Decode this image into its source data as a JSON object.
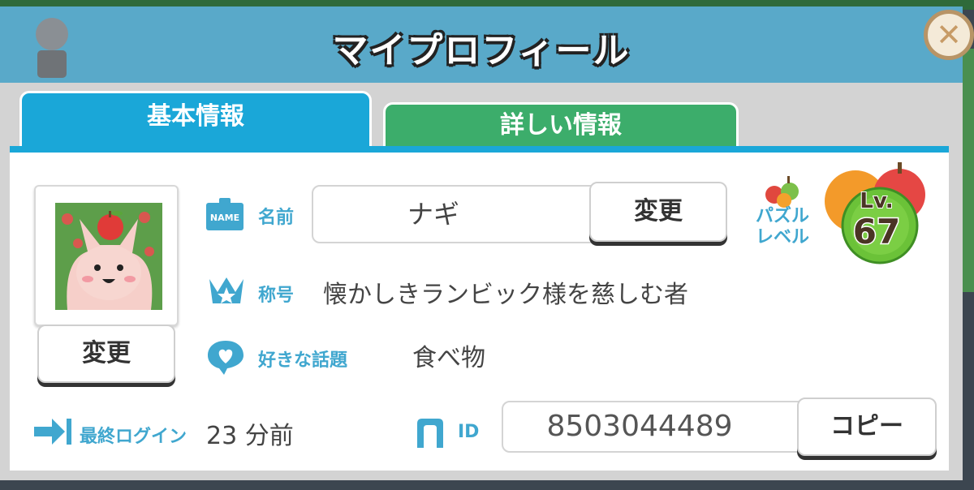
{
  "header": {
    "title": "マイプロフィール"
  },
  "tabs": [
    {
      "label": "基本情報",
      "active": true
    },
    {
      "label": "詳しい情報",
      "active": false
    }
  ],
  "avatar": {
    "change_label": "変更"
  },
  "name": {
    "label": "名前",
    "value": "ナギ",
    "change_label": "変更",
    "badge_text": "NAME"
  },
  "title_field": {
    "label": "称号",
    "value": "懐かしきランビック様を慈しむ者"
  },
  "favorite": {
    "label": "好きな話題",
    "value": "食べ物"
  },
  "last_login": {
    "label": "最終ログイン",
    "value": "23 分前"
  },
  "id_field": {
    "label": "ID",
    "value": "8503044489",
    "copy_label": "コピー"
  },
  "puzzle_level": {
    "label_line1": "パズル",
    "label_line2": "レベル",
    "lv_prefix": "Lv.",
    "level": "67"
  },
  "colors": {
    "header": "#59a9c9",
    "tab_active": "#1aa7d8",
    "tab_inactive": "#3cad6b",
    "label": "#40a7cf"
  }
}
